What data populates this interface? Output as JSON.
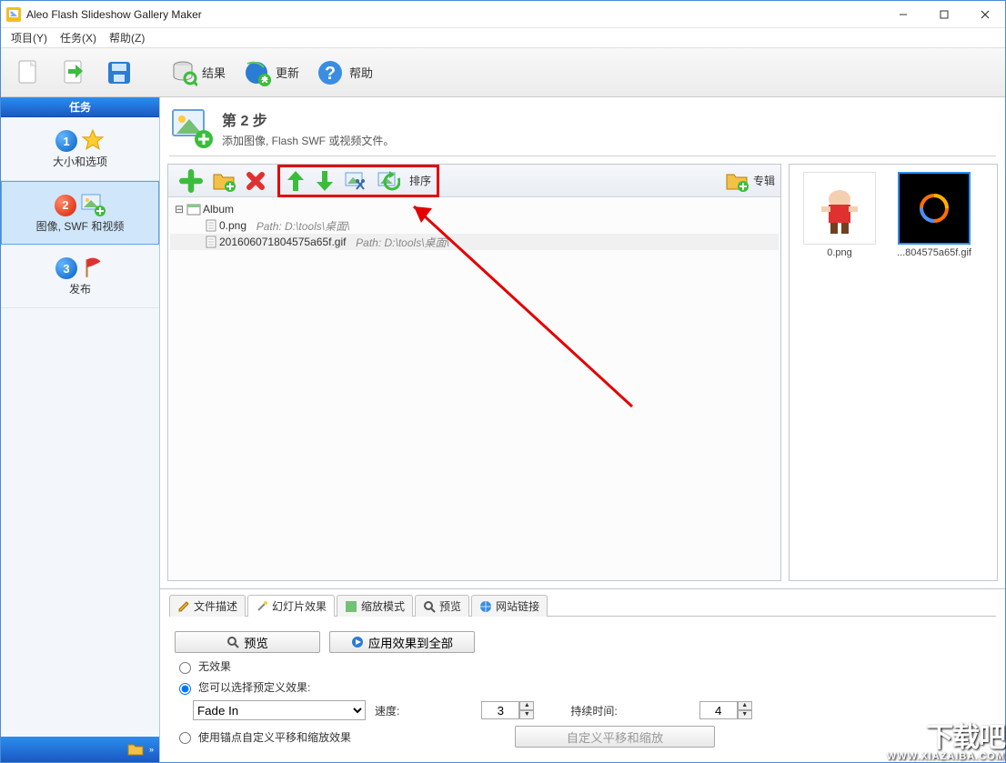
{
  "app_title": "Aleo Flash Slideshow Gallery Maker",
  "menu": {
    "project": "项目(Y)",
    "task": "任务(X)",
    "help": "帮助(Z)"
  },
  "toolbar": {
    "result": "结果",
    "update": "更新",
    "help": "帮助"
  },
  "side": {
    "header": "任务",
    "t1": "大小和选项",
    "t2": "图像, SWF 和视频",
    "t3": "发布"
  },
  "step": {
    "title": "第 2 步",
    "sub": "添加图像, Flash SWF 或视频文件。"
  },
  "ftb": {
    "sort": "排序",
    "album": "专辑"
  },
  "tree": {
    "root": "Album",
    "items": [
      {
        "name": "0.png",
        "path": "Path: D:\\tools\\桌面\\"
      },
      {
        "name": "2016060718045​75a65f.gif",
        "path": "Path: D:\\tools\\桌面\\"
      }
    ]
  },
  "thumbs": [
    {
      "caption": "0.png"
    },
    {
      "caption": "...804575a65f.gif"
    }
  ],
  "tabs": {
    "desc": "文件描述",
    "effect": "幻灯片效果",
    "zoom": "缩放模式",
    "preview": "预览",
    "links": "网站链接"
  },
  "panel": {
    "preview_btn": "预览",
    "apply_btn": "应用效果到全部",
    "no_effect": "无效果",
    "predef": "您可以选择预定义效果:",
    "select_value": "Fade In",
    "speed_label": "速度:",
    "speed_value": "3",
    "duration_label": "持续时间:",
    "duration_value": "4",
    "anchor": "使用锚点自定义平移和缩放效果",
    "custom_btn": "自定义平移和缩放"
  },
  "watermark": {
    "big": "下载吧",
    "small": "WWW.XIAZAIBA.COM"
  }
}
